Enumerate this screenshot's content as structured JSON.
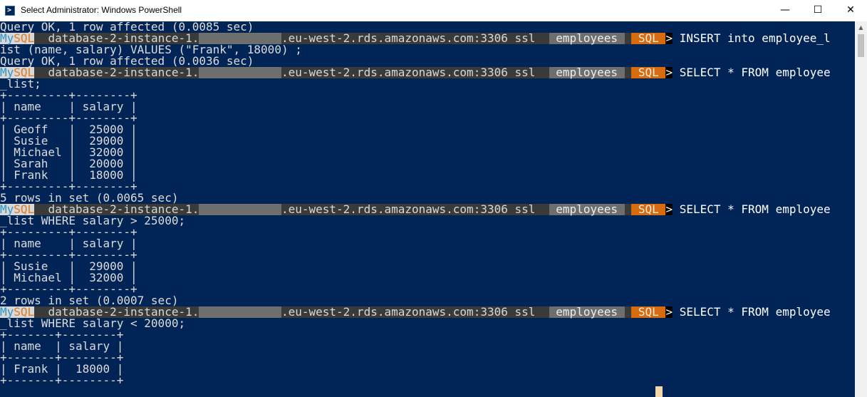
{
  "window": {
    "title": "Select Administrator: Windows PowerShell",
    "app_icon_glyph": ">",
    "minimize_glyph": "—",
    "maximize_glyph": "☐",
    "close_glyph": "✕"
  },
  "colors": {
    "console_background": "#012456",
    "mysql_blue": "#2f95c8",
    "mysql_orange": "#e27a1f",
    "sql_mode_background": "#d86b0c",
    "database_segment_background": "#6e6e6e"
  },
  "prompt": {
    "brand_my": "My",
    "brand_sql": "SQL",
    "host_prefix": " database-2-instance-1.",
    "host_redacted": "            ",
    "host_suffix": ".eu-west-2.rds.amazonaws.com:3306 ssl ",
    "separator": " ",
    "database": " employees ",
    "mode": " SQL ",
    "arrow": ">"
  },
  "console": {
    "line_01": "Query OK, 1 row affected (0.0085 sec)",
    "cmd_1": " INSERT into employee_l",
    "line_03": "ist (name, salary) VALUES (\"Frank\", 18000) ;",
    "line_04": "Query OK, 1 row affected (0.0036 sec)",
    "cmd_2": " SELECT * FROM employee",
    "line_06": "_list;",
    "line_07": "+---------+--------+",
    "line_08": "| name    | salary |",
    "line_09": "+---------+--------+",
    "line_10": "| Geoff   |  25000 |",
    "line_11": "| Susie   |  29000 |",
    "line_12": "| Michael |  32000 |",
    "line_13": "| Sarah   |  20000 |",
    "line_14": "| Frank   |  18000 |",
    "line_15": "+---------+--------+",
    "line_16": "5 rows in set (0.0065 sec)",
    "cmd_3": " SELECT * FROM employee",
    "line_18": "_list WHERE salary > 25000;",
    "line_19": "+---------+--------+",
    "line_20": "| name    | salary |",
    "line_21": "+---------+--------+",
    "line_22": "| Susie   |  29000 |",
    "line_23": "| Michael |  32000 |",
    "line_24": "+---------+--------+",
    "line_25": "2 rows in set (0.0007 sec)",
    "cmd_4": " SELECT * FROM employee",
    "line_27": "_list WHERE salary < 20000;",
    "line_28": "+-------+--------+",
    "line_29": "| name  | salary |",
    "line_30": "+-------+--------+",
    "line_31": "| Frank |  18000 |",
    "line_32": "+-------+--------+"
  },
  "scrollbar": {
    "up_arrow_glyph": "▲"
  }
}
